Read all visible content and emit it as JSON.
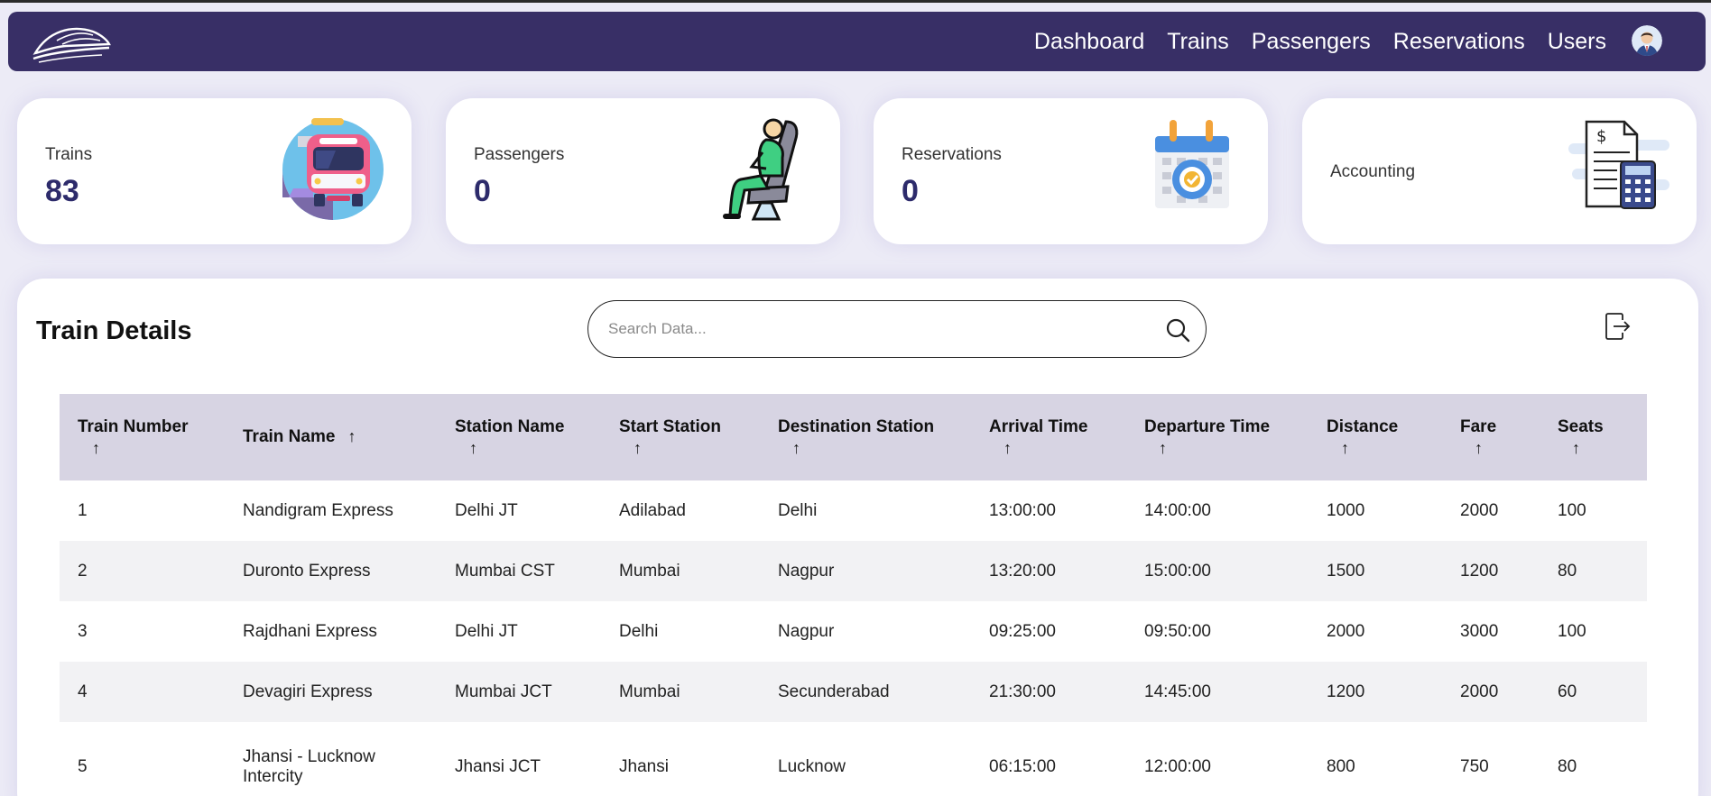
{
  "nav": {
    "links": [
      "Dashboard",
      "Trains",
      "Passengers",
      "Reservations",
      "Users"
    ],
    "brand_color": "#382f66"
  },
  "cards": [
    {
      "label": "Trains",
      "value": "83",
      "icon": "train-icon"
    },
    {
      "label": "Passengers",
      "value": "0",
      "icon": "passenger-seat-icon"
    },
    {
      "label": "Reservations",
      "value": "0",
      "icon": "calendar-icon"
    },
    {
      "label": "Accounting",
      "icon": "accounting-icon"
    }
  ],
  "panel": {
    "title": "Train Details",
    "search_placeholder": "Search Data..."
  },
  "table": {
    "sort_arrow": "↑",
    "columns": [
      "Train Number",
      "Train Name",
      "Station Name",
      "Start Station",
      "Destination Station",
      "Arrival Time",
      "Departure Time",
      "Distance",
      "Fare",
      "Seats"
    ],
    "rows": [
      [
        "1",
        "Nandigram Express",
        "Delhi JT",
        "Adilabad",
        "Delhi",
        "13:00:00",
        "14:00:00",
        "1000",
        "2000",
        "100"
      ],
      [
        "2",
        "Duronto Express",
        "Mumbai CST",
        "Mumbai",
        "Nagpur",
        "13:20:00",
        "15:00:00",
        "1500",
        "1200",
        "80"
      ],
      [
        "3",
        "Rajdhani Express",
        "Delhi JT",
        "Delhi",
        "Nagpur",
        "09:25:00",
        "09:50:00",
        "2000",
        "3000",
        "100"
      ],
      [
        "4",
        "Devagiri Express",
        "Mumbai JCT",
        "Mumbai",
        "Secunderabad",
        "21:30:00",
        "14:45:00",
        "1200",
        "2000",
        "60"
      ],
      [
        "5",
        "Jhansi - Lucknow Intercity",
        "Jhansi JCT",
        "Jhansi",
        "Lucknow",
        "06:15:00",
        "12:00:00",
        "800",
        "750",
        "80"
      ]
    ]
  }
}
